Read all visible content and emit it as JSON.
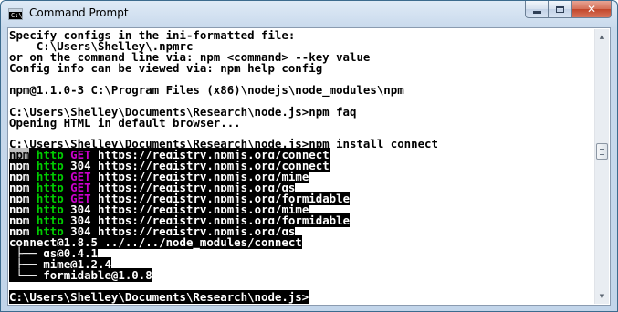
{
  "window": {
    "title": "Command Prompt",
    "icon_label": "C:\\",
    "icon": "cmd-window-icon",
    "minimize_icon": "minimize-icon",
    "maximize_icon": "maximize-icon",
    "close_icon": "close-icon",
    "close_glyph": "✕"
  },
  "console": {
    "plain_lines": [
      "Specify configs in the ini-formatted file:",
      "    C:\\Users\\Shelley\\.npmrc",
      "or on the command line via: npm <command> --key value",
      "Config info can be viewed via: npm help config",
      "",
      "npm@1.1.0-3 C:\\Program Files (x86)\\nodejs\\node_modules\\npm",
      "",
      "C:\\Users\\Shelley\\Documents\\Research\\node.js>npm faq",
      "Opening HTML in default browser...",
      "",
      "C:\\Users\\Shelley\\Documents\\Research\\node.js>npm install connect"
    ],
    "http_lines": [
      {
        "npm": "npm",
        "http": "http",
        "method": "GET",
        "url": "https://registry.npmjs.org/connect"
      },
      {
        "npm": "npm",
        "http": "http",
        "method": "304",
        "url": "https://registry.npmjs.org/connect"
      },
      {
        "npm": "npm",
        "http": "http",
        "method": "GET",
        "url": "https://registry.npmjs.org/mime"
      },
      {
        "npm": "npm",
        "http": "http",
        "method": "GET",
        "url": "https://registry.npmjs.org/qs"
      },
      {
        "npm": "npm",
        "http": "http",
        "method": "GET",
        "url": "https://registry.npmjs.org/formidable"
      },
      {
        "npm": "npm",
        "http": "http",
        "method": "304",
        "url": "https://registry.npmjs.org/mime"
      },
      {
        "npm": "npm",
        "http": "http",
        "method": "304",
        "url": "https://registry.npmjs.org/formidable"
      },
      {
        "npm": "npm",
        "http": "http",
        "method": "304",
        "url": "https://registry.npmjs.org/qs"
      }
    ],
    "tree": {
      "root": "connect@1.8.5 ../../../node_modules/connect",
      "children": [
        {
          "prefix": " ├── ",
          "name": "qs@0.4.1"
        },
        {
          "prefix": " ├── ",
          "name": "mime@1.2.4"
        },
        {
          "prefix": " └── ",
          "name": "formidable@1.0.8"
        }
      ]
    },
    "prompt": "C:\\Users\\Shelley\\Documents\\Research\\node.js>"
  },
  "colors": {
    "method_get": "#cc00cc",
    "method_304": "#ffffff",
    "http_green": "#00cc00",
    "inverse_bg": "#000000"
  }
}
